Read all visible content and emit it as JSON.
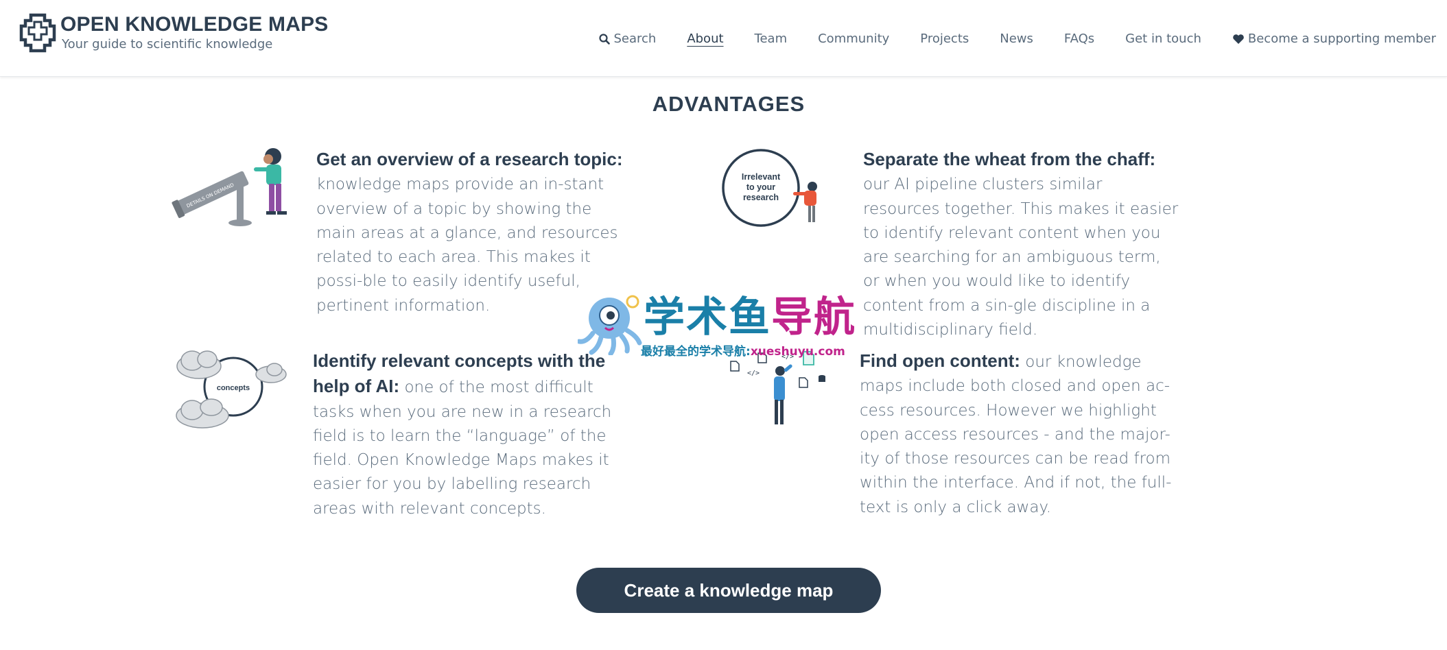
{
  "header": {
    "title": "OPEN KNOWLEDGE MAPS",
    "subtitle": "Your guide to scientific knowledge",
    "nav": [
      {
        "label": "Search",
        "icon": "search-icon"
      },
      {
        "label": "About",
        "active": true
      },
      {
        "label": "Team"
      },
      {
        "label": "Community"
      },
      {
        "label": "Projects"
      },
      {
        "label": "News"
      },
      {
        "label": "FAQs"
      },
      {
        "label": "Get in touch"
      },
      {
        "label": "Become a supporting member",
        "icon": "heart-icon"
      }
    ]
  },
  "section": {
    "title": "ADVANTAGES",
    "cards": [
      {
        "lead": "Get an overview of a research topic:",
        "body": " knowledge maps provide an in-stant overview of a topic by showing the main areas at a glance, and resources related to each area. This makes it possi-ble to easily identify useful, pertinent information.",
        "illustration": "telescope-illustration",
        "illustration_text": "DETAILS ON DEMAND"
      },
      {
        "lead": "Separate the wheat from the chaff:",
        "body": " our AI pipeline clusters similar resources together. This makes it easier to identify relevant content when you are searching for an ambiguous term, or when you would like to identify content from a sin-gle discipline in a multidisciplinary field.",
        "illustration": "irrelevant-circle-illustration",
        "illustration_text": "Irrelevant to your research"
      },
      {
        "lead": "Identify relevant concepts with the help of AI:",
        "body": " one of the most difficult tasks when you are new in a research field is to learn the “language” of the field. Open Knowledge Maps makes it easier for you by labelling research areas with relevant concepts.",
        "illustration": "concepts-clouds-illustration",
        "illustration_text": "concepts"
      },
      {
        "lead": "Find open content:",
        "body": " our knowledge maps include both closed and open ac-cess resources. However we highlight open access resources - and the major-ity of those resources can be read from within the interface. And if not, the full-text is only a click away.",
        "illustration": "open-content-illustration"
      }
    ],
    "cta_label": "Create a knowledge map"
  },
  "watermark": {
    "title_a": "学术鱼",
    "title_b": "导航",
    "sub_a": "最好最全的学术导航:",
    "sub_b": "xueshuyu.com",
    "colors": {
      "blue": "#1a7fa8",
      "magenta": "#c0238b"
    }
  },
  "colors": {
    "primary": "#2d3e50",
    "text": "#5a6b7c",
    "accent_teal": "#3bb8a5",
    "accent_purple": "#8e4fa3",
    "accent_orange": "#e8573a"
  }
}
